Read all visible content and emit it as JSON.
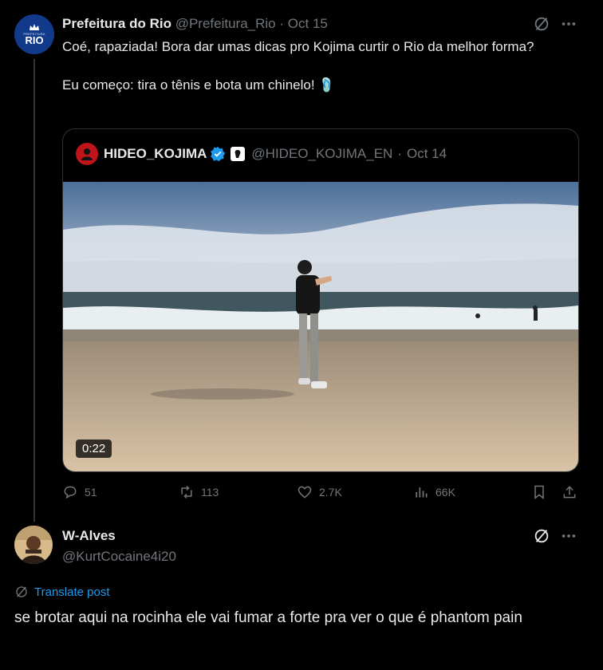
{
  "post": {
    "author_name": "Prefeitura do Rio",
    "handle": "@Prefeitura_Rio",
    "separator": "·",
    "date": "Oct 15",
    "avatar_small_text": "PREFEITURA",
    "avatar_text": "RIO",
    "text_line1": "Coé, rapaziada! Bora dar umas dicas pro Kojima curtir o Rio da melhor forma?",
    "text_line2": "Eu começo: tira o tênis e bota um chinelo! 🩴",
    "icons": [
      "grok-icon",
      "more-icon"
    ]
  },
  "quote": {
    "author_name": "HIDEO_KOJIMA",
    "handle": "@HIDEO_KOJIMA_EN",
    "separator": "·",
    "date": "Oct 14",
    "video_duration": "0:22",
    "icons": [
      "verified-badge-icon",
      "affiliate-badge-icon"
    ]
  },
  "actions": {
    "replies": "51",
    "reposts": "113",
    "likes": "2.7K",
    "views": "66K",
    "icons": [
      "reply-icon",
      "repost-icon",
      "like-icon",
      "views-icon",
      "bookmark-icon",
      "share-icon"
    ]
  },
  "reply": {
    "author_name": "W-Alves",
    "handle": "@KurtCocaine4i20",
    "translate_label": "Translate post",
    "text": "se brotar aqui na rocinha ele vai fumar a forte pra ver o que é phantom pain",
    "icons": [
      "grok-icon",
      "more-icon",
      "globe-icon"
    ]
  },
  "colors": {
    "background": "#000000",
    "text": "#e7e9ea",
    "muted": "#71767b",
    "accent": "#1d9bf0",
    "border": "#2f3336"
  }
}
